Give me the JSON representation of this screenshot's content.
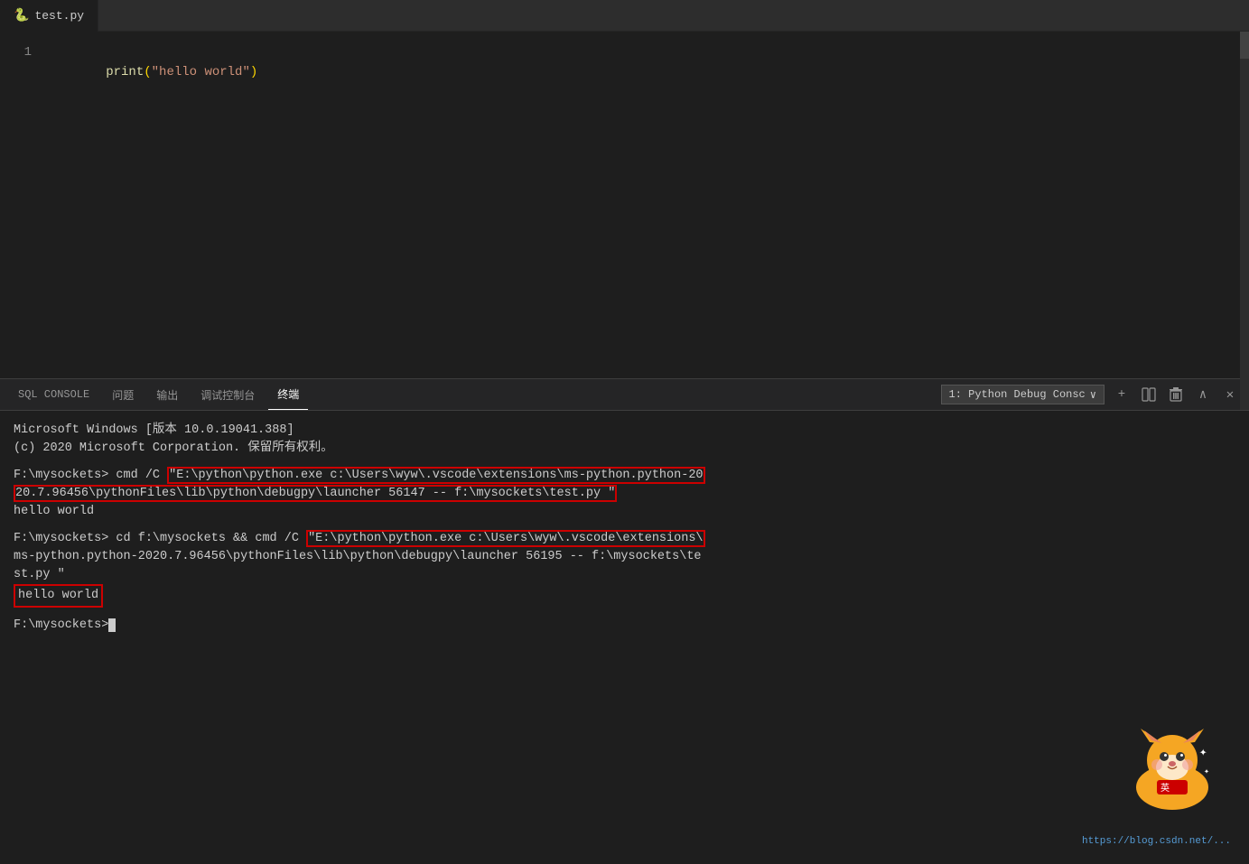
{
  "editor": {
    "tab": {
      "icon": "🐍",
      "filename": "test.py"
    },
    "lines": [
      {
        "number": "1",
        "content": "print(\"hello world\")"
      }
    ]
  },
  "terminal_panel": {
    "tabs": [
      {
        "id": "sql-console",
        "label": "SQL CONSOLE",
        "active": false
      },
      {
        "id": "problems",
        "label": "问题",
        "active": false
      },
      {
        "id": "output",
        "label": "输出",
        "active": false
      },
      {
        "id": "debug-console",
        "label": "调试控制台",
        "active": false
      },
      {
        "id": "terminal",
        "label": "终端",
        "active": true
      }
    ],
    "terminal_selector": "1: Python Debug Consc",
    "controls": {
      "add": "+",
      "split": "⧉",
      "trash": "🗑",
      "chevron_up": "∧",
      "close": "✕"
    },
    "output_lines": [
      "Microsoft Windows [版本 10.0.19041.388]",
      "(c) 2020 Microsoft Corporation. 保留所有权利。",
      "",
      "F:\\mysockets> cmd /C \"E:\\python\\python.exe c:\\Users\\wyw\\.vscode\\extensions\\ms-python.python-2020.7.96456\\pythonFiles\\lib\\python\\debugpy\\launcher 56147 -- f:\\mysockets\\test.py \"",
      "hello world",
      "",
      "F:\\mysockets> cd f:\\mysockets && cmd /C \"E:\\python\\python.exe c:\\Users\\wyw\\.vscode\\extensions\\ms-python.python-2020.7.96456\\pythonFiles\\lib\\python\\debugpy\\launcher 56195 -- f:\\mysockets\\test.py \"",
      "hello world",
      "",
      "F:\\mysockets>"
    ],
    "url": "https://blog.csdn.net/..."
  }
}
